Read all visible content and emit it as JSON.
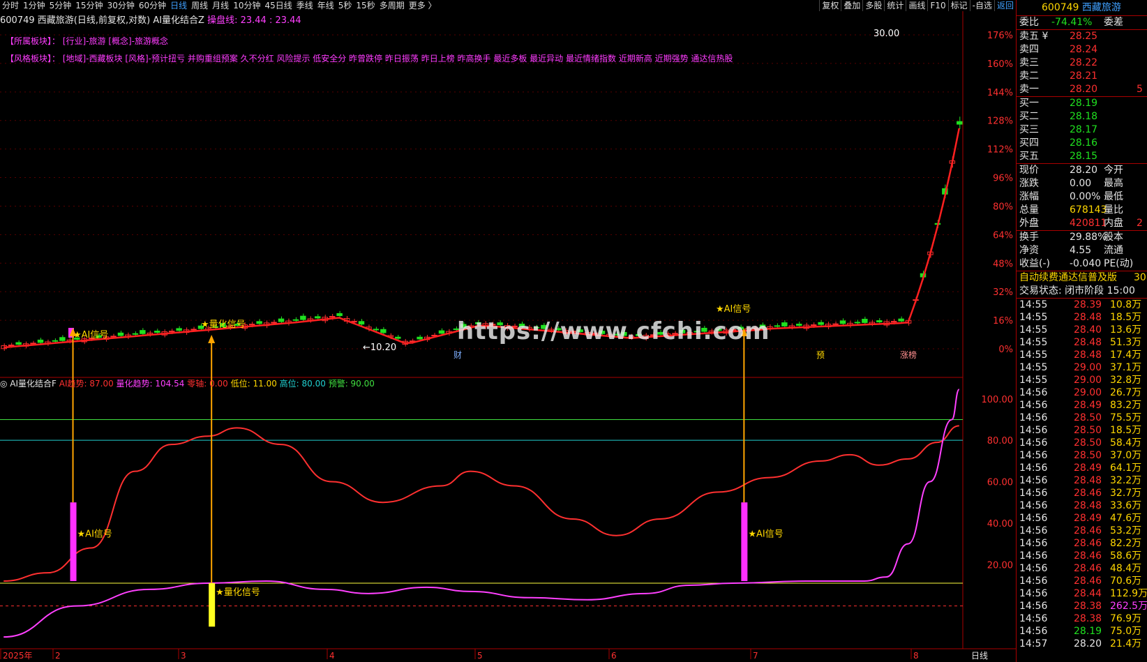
{
  "toolbar": {
    "periods": [
      "分时",
      "1分钟",
      "5分钟",
      "15分钟",
      "30分钟",
      "60分钟",
      "日线",
      "周线",
      "月线",
      "10分钟",
      "45日线",
      "季线",
      "年线",
      "5秒",
      "15秒",
      "多周期",
      "更多 〉"
    ],
    "active": "日线",
    "tools": [
      "复权",
      "叠加",
      "多股",
      "统计",
      "画线",
      "F10",
      "标记",
      "-自选",
      "返回"
    ]
  },
  "main": {
    "title": "600749 西藏旅游(日线,前复权,对数)",
    "indicator": "AI量化结合Z",
    "line_label": "操盘线: 23.44 : 23.44",
    "sector1": "【所属板块】： [行业]-旅游 [概念]-旅游概念",
    "sector2": "【风格板块】： [地域]-西藏板块 [风格]-预计扭亏 并购重组预案 久不分红 风险提示 低安全分 昨曾跌停 昨日振荡 昨日上榜 昨高换手 最近多板 最近异动 最近情绪指数 近期新高 近期强势 通达信热股",
    "peak_label": "30.00",
    "low_label": "10.20",
    "signal_ai": "★AI信号",
    "signal_quant": "★量化信号",
    "flags": [
      "财",
      "预",
      "涨榜"
    ],
    "right_axis": [
      "176%",
      "160%",
      "144%",
      "128%",
      "112%",
      "96%",
      "80%",
      "64%",
      "48%",
      "32%",
      "16%",
      "0%"
    ]
  },
  "indicator_panel": {
    "name": "AI量化结合F",
    "values": [
      {
        "label": "AI趋势: 87.00",
        "color": "#ff3030"
      },
      {
        "label": "量化趋势: 104.54",
        "color": "#ff40ff"
      },
      {
        "label": "零轴: 0.00",
        "color": "#ff3030"
      },
      {
        "label": "低位: 11.00",
        "color": "#ffd700"
      },
      {
        "label": "高位: 80.00",
        "color": "#20d0d0"
      },
      {
        "label": "预警: 90.00",
        "color": "#40e040"
      }
    ],
    "right_axis": [
      "100.00",
      "80.00",
      "60.00",
      "40.00",
      "20.00"
    ]
  },
  "x_axis": {
    "labels": [
      "2025年",
      "2",
      "3",
      "4",
      "5",
      "6",
      "7",
      "8"
    ],
    "period": "日线"
  },
  "watermark": "https://www.cfchi.com",
  "quote": {
    "code": "600749",
    "name": "西藏旅游",
    "wb_label": "委比",
    "wb_value": "-74.41%",
    "wc_label": "委差",
    "sells": [
      {
        "label": "卖五 ¥",
        "price": "28.25"
      },
      {
        "label": "卖四",
        "price": "28.24"
      },
      {
        "label": "卖三",
        "price": "28.22"
      },
      {
        "label": "卖二",
        "price": "28.21"
      },
      {
        "label": "卖一",
        "price": "28.20",
        "extra": "5"
      }
    ],
    "buys": [
      {
        "label": "买一",
        "price": "28.19"
      },
      {
        "label": "买二",
        "price": "28.18"
      },
      {
        "label": "买三",
        "price": "28.17"
      },
      {
        "label": "买四",
        "price": "28.16"
      },
      {
        "label": "买五",
        "price": "28.15"
      }
    ],
    "stats": [
      {
        "a": "现价",
        "b": "28.20",
        "c": "今开",
        "bc": "wht"
      },
      {
        "a": "涨跌",
        "b": "0.00",
        "c": "最高",
        "bc": "wht"
      },
      {
        "a": "涨幅",
        "b": "0.00%",
        "c": "最低",
        "bc": "wht"
      },
      {
        "a": "总量",
        "b": "678143",
        "c": "量比",
        "bc": "yel"
      },
      {
        "a": "外盘",
        "b": "420811",
        "c": "内盘",
        "bc": "red",
        "extra": "2"
      }
    ],
    "stats2": [
      {
        "a": "换手",
        "b": "29.88%",
        "c": "股本",
        "bc": "wht"
      },
      {
        "a": "净资",
        "b": "4.55",
        "c": "流通",
        "bc": "wht"
      },
      {
        "a": "收益(-)",
        "b": "-0.040",
        "c": "PE(动)",
        "bc": "wht"
      }
    ],
    "promo": "自动续费通达信普及版",
    "promo_extra": "30",
    "trade_state": "交易状态: 闭市阶段 15:00",
    "ticks": [
      {
        "t": "14:55",
        "p": "28.39",
        "v": "10.8万",
        "pc": "red",
        "vc": "yel"
      },
      {
        "t": "14:55",
        "p": "28.48",
        "v": "18.5万",
        "pc": "red",
        "vc": "yel"
      },
      {
        "t": "14:55",
        "p": "28.40",
        "v": "13.6万",
        "pc": "red",
        "vc": "yel"
      },
      {
        "t": "14:55",
        "p": "28.48",
        "v": "51.3万",
        "pc": "red",
        "vc": "yel"
      },
      {
        "t": "14:55",
        "p": "28.48",
        "v": "17.4万",
        "pc": "red",
        "vc": "yel"
      },
      {
        "t": "14:55",
        "p": "29.00",
        "v": "37.1万",
        "pc": "red",
        "vc": "yel"
      },
      {
        "t": "14:55",
        "p": "29.00",
        "v": "32.8万",
        "pc": "red",
        "vc": "yel"
      },
      {
        "t": "14:56",
        "p": "29.00",
        "v": "26.7万",
        "pc": "red",
        "vc": "yel"
      },
      {
        "t": "14:56",
        "p": "28.49",
        "v": "83.2万",
        "pc": "red",
        "vc": "yel"
      },
      {
        "t": "14:56",
        "p": "28.50",
        "v": "75.5万",
        "pc": "red",
        "vc": "yel"
      },
      {
        "t": "14:56",
        "p": "28.50",
        "v": "18.5万",
        "pc": "red",
        "vc": "yel"
      },
      {
        "t": "14:56",
        "p": "28.50",
        "v": "58.4万",
        "pc": "red",
        "vc": "yel"
      },
      {
        "t": "14:56",
        "p": "28.50",
        "v": "37.0万",
        "pc": "red",
        "vc": "yel"
      },
      {
        "t": "14:56",
        "p": "28.49",
        "v": "64.1万",
        "pc": "red",
        "vc": "yel"
      },
      {
        "t": "14:56",
        "p": "28.48",
        "v": "32.2万",
        "pc": "red",
        "vc": "yel"
      },
      {
        "t": "14:56",
        "p": "28.46",
        "v": "32.7万",
        "pc": "red",
        "vc": "yel"
      },
      {
        "t": "14:56",
        "p": "28.48",
        "v": "33.6万",
        "pc": "red",
        "vc": "yel"
      },
      {
        "t": "14:56",
        "p": "28.49",
        "v": "47.6万",
        "pc": "red",
        "vc": "yel"
      },
      {
        "t": "14:56",
        "p": "28.46",
        "v": "53.2万",
        "pc": "red",
        "vc": "yel"
      },
      {
        "t": "14:56",
        "p": "28.46",
        "v": "82.2万",
        "pc": "red",
        "vc": "yel"
      },
      {
        "t": "14:56",
        "p": "28.46",
        "v": "58.6万",
        "pc": "red",
        "vc": "yel"
      },
      {
        "t": "14:56",
        "p": "28.46",
        "v": "48.4万",
        "pc": "red",
        "vc": "yel"
      },
      {
        "t": "14:56",
        "p": "28.46",
        "v": "70.6万",
        "pc": "red",
        "vc": "yel"
      },
      {
        "t": "14:56",
        "p": "28.44",
        "v": "112.9万",
        "pc": "red",
        "vc": "yel"
      },
      {
        "t": "14:56",
        "p": "28.38",
        "v": "262.5万",
        "pc": "red",
        "vc": "mag"
      },
      {
        "t": "14:56",
        "p": "28.38",
        "v": "76.9万",
        "pc": "red",
        "vc": "yel"
      },
      {
        "t": "14:56",
        "p": "28.19",
        "v": "75.0万",
        "pc": "green",
        "vc": "yel"
      },
      {
        "t": "14:57",
        "p": "28.20",
        "v": "21.4万",
        "pc": "wht",
        "vc": "yel"
      }
    ]
  },
  "chart_data": {
    "type": "line",
    "title": "600749 西藏旅游(日线,前复权,对数)",
    "subtitle": "AI量化结合F",
    "x": [
      "2025年",
      "2",
      "3",
      "4",
      "5",
      "6",
      "7",
      "8"
    ],
    "series": [
      {
        "name": "AI趋势",
        "color": "#ff3030",
        "points": [
          [
            0,
            12
          ],
          [
            6,
            16
          ],
          [
            12,
            28
          ],
          [
            18,
            65
          ],
          [
            23,
            78
          ],
          [
            28,
            82
          ],
          [
            32,
            86
          ],
          [
            38,
            78
          ],
          [
            45,
            60
          ],
          [
            52,
            50
          ],
          [
            60,
            58
          ],
          [
            64,
            65
          ],
          [
            70,
            58
          ],
          [
            78,
            42
          ],
          [
            84,
            34
          ],
          [
            90,
            42
          ],
          [
            98,
            55
          ],
          [
            105,
            62
          ],
          [
            112,
            70
          ],
          [
            116,
            73
          ],
          [
            120,
            68
          ],
          [
            124,
            71
          ],
          [
            128,
            79
          ],
          [
            131,
            87
          ]
        ]
      },
      {
        "name": "量化趋势",
        "color": "#ff40ff",
        "points": [
          [
            0,
            -15
          ],
          [
            10,
            0
          ],
          [
            20,
            8
          ],
          [
            28,
            11
          ],
          [
            36,
            12
          ],
          [
            44,
            8
          ],
          [
            50,
            6
          ],
          [
            58,
            9
          ],
          [
            64,
            7
          ],
          [
            72,
            4
          ],
          [
            80,
            3
          ],
          [
            88,
            6
          ],
          [
            94,
            10
          ],
          [
            100,
            11
          ],
          [
            110,
            12
          ],
          [
            118,
            12
          ],
          [
            121,
            14
          ],
          [
            124,
            30
          ],
          [
            127,
            60
          ],
          [
            130,
            90
          ],
          [
            131,
            104.54
          ]
        ]
      }
    ],
    "levels": {
      "零轴": 0.0,
      "低位": 11.0,
      "高位": 80.0,
      "预警": 90.0
    },
    "ylim": [
      -20,
      108
    ],
    "price": {
      "low": 10.2,
      "high": 30.0,
      "last": 28.2
    },
    "signals": [
      {
        "type": "AI信号",
        "index": 10
      },
      {
        "type": "量化信号",
        "index": 29
      },
      {
        "type": "AI信号",
        "index": 102
      }
    ]
  }
}
